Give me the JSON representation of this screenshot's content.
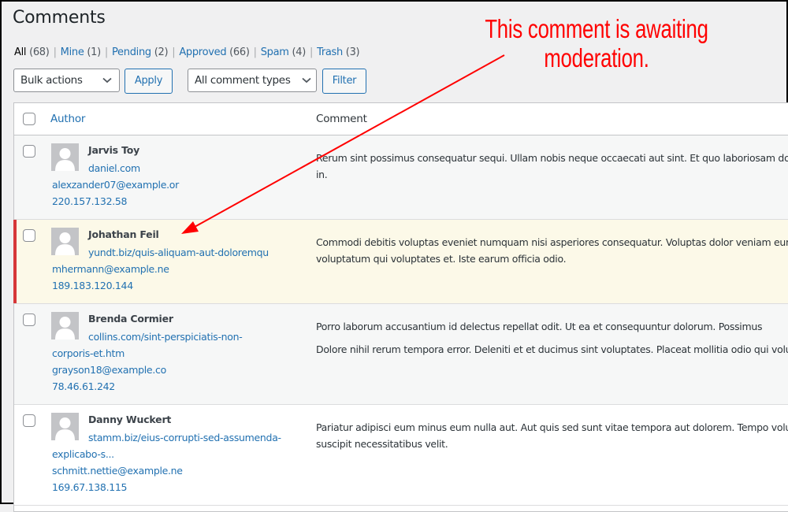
{
  "page": {
    "title": "Comments"
  },
  "filters": [
    {
      "label": "All",
      "count": "(68)",
      "current": true
    },
    {
      "label": "Mine",
      "count": "(1)",
      "current": false
    },
    {
      "label": "Pending",
      "count": "(2)",
      "current": false
    },
    {
      "label": "Approved",
      "count": "(66)",
      "current": false
    },
    {
      "label": "Spam",
      "count": "(4)",
      "current": false
    },
    {
      "label": "Trash",
      "count": "(3)",
      "current": false
    }
  ],
  "filter_separator": "|",
  "toolbar": {
    "bulk_actions": "Bulk actions",
    "apply": "Apply",
    "comment_types": "All comment types",
    "filter": "Filter"
  },
  "table": {
    "columns": {
      "author": "Author",
      "comment": "Comment"
    },
    "rows": [
      {
        "status": "approved",
        "author": "Jarvis Toy",
        "url": "daniel.com",
        "email": "alexzander07@example.or",
        "ip": "220.157.132.58",
        "comment": [
          "Rerum sint possimus consequatur sequi. Ullam nobis neque occaecati aut sint. Et quo laboriosam dolore laboriosam in."
        ]
      },
      {
        "status": "pending",
        "author": "Johathan Feil",
        "url": "yundt.biz/quis-aliquam-aut-doloremqu",
        "email": "mhermann@example.ne",
        "ip": "189.183.120.144",
        "comment": [
          "Commodi debitis voluptas eveniet numquam nisi asperiores consequatur. Voluptas dolor veniam eum deleniti voluptatum qui voluptates et. Iste earum officia odio."
        ]
      },
      {
        "status": "approved",
        "author": "Brenda Cormier",
        "url": "collins.com/sint-perspiciatis-non-corporis-et.htm",
        "email": "grayson18@example.co",
        "ip": "78.46.61.242",
        "comment": [
          "Porro laborum accusantium id delectus repellat odit. Ut ea et consequuntur dolorum. Possimus",
          "Dolore nihil rerum tempora error. Deleniti et et ducimus sint voluptates. Placeat mollitia odio qui voluptatem itaque."
        ]
      },
      {
        "status": "approved",
        "author": "Danny Wuckert",
        "url": "stamm.biz/eius-corrupti-sed-assumenda-explicabo-s...",
        "email": "schmitt.nettie@example.ne",
        "ip": "169.67.138.115",
        "comment": [
          "Pariatur adipisci eum minus eum nulla aut. Aut quis sed sunt vitae tempora aut dolorem. Tempo voluptatibus. Eum suscipit necessitatibus velit."
        ]
      }
    ]
  },
  "annotation": {
    "line1": "This comment is awaiting",
    "line2": "moderation.",
    "color": "#ff0000"
  },
  "colors": {
    "link": "#2271b1",
    "pending_bar": "#d63638",
    "pending_bg": "#fcf9e8"
  }
}
